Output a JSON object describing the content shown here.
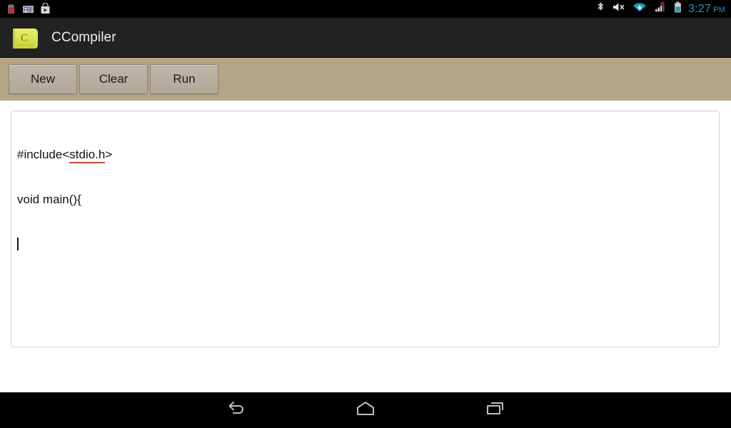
{
  "status_bar": {
    "notifications": [
      {
        "name": "battery-low-notification-icon",
        "label": "battery"
      },
      {
        "name": "contact-card-notification-icon",
        "label": "contact card"
      },
      {
        "name": "play-store-notification-icon",
        "label": "play store"
      }
    ],
    "system_icons": [
      {
        "name": "bluetooth-icon",
        "label": "Bluetooth"
      },
      {
        "name": "volume-muted-icon",
        "label": "Volume muted"
      },
      {
        "name": "wifi-icon",
        "label": "Wi-Fi connected"
      },
      {
        "name": "cellular-signal-no-service-icon",
        "label": "Cellular no service"
      },
      {
        "name": "battery-icon",
        "label": "Battery"
      }
    ],
    "clock": "3:27",
    "clock_ampm": "PM",
    "clock_color": "#2196c4",
    "background": "#000000"
  },
  "action_bar": {
    "app_title": "CCompiler",
    "app_icon_letter": "C",
    "app_icon_name": "ccompiler-app-icon",
    "background": "#222222",
    "title_color": "#ededed"
  },
  "toolbar": {
    "background": "#b5a587",
    "buttons": [
      {
        "label": "New",
        "name": "new-button"
      },
      {
        "label": "Clear",
        "name": "clear-button"
      },
      {
        "label": "Run",
        "name": "run-button"
      }
    ]
  },
  "editor": {
    "name": "code-editor",
    "background": "#ffffff",
    "border_color": "#d2d2d2",
    "misspell_underline_color": "#d04a3e",
    "lines": [
      {
        "prefix": "#include<",
        "misspelled": "stdio.h",
        "suffix": ">"
      },
      {
        "prefix": "void main(){",
        "misspelled": "",
        "suffix": ""
      },
      {
        "prefix": "",
        "misspelled": "",
        "suffix": "",
        "caret": true
      }
    ],
    "full_text": "#include<stdio.h>\nvoid main(){\n"
  },
  "nav_bar": {
    "background": "#000000",
    "buttons": [
      {
        "name": "nav-back-button",
        "label": "Back"
      },
      {
        "name": "nav-home-button",
        "label": "Home"
      },
      {
        "name": "nav-recents-button",
        "label": "Recent apps"
      }
    ]
  }
}
